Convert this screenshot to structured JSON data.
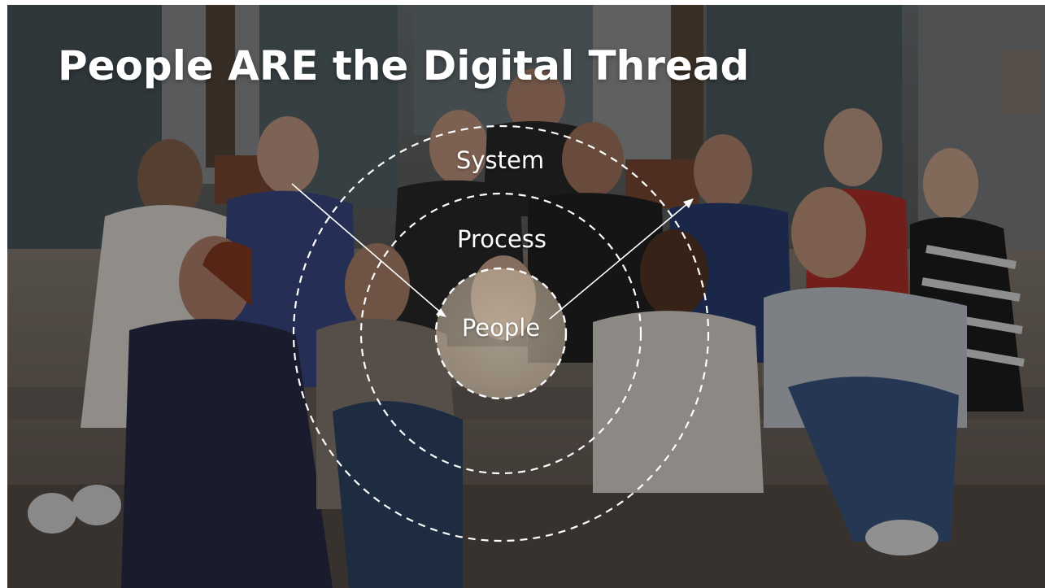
{
  "slide": {
    "title": "People ARE the Digital Thread",
    "diagram": {
      "rings": [
        {
          "label": "System"
        },
        {
          "label": "Process"
        },
        {
          "label": "People"
        }
      ]
    },
    "colors": {
      "text": "#ffffff",
      "overlay": "#000000"
    }
  }
}
